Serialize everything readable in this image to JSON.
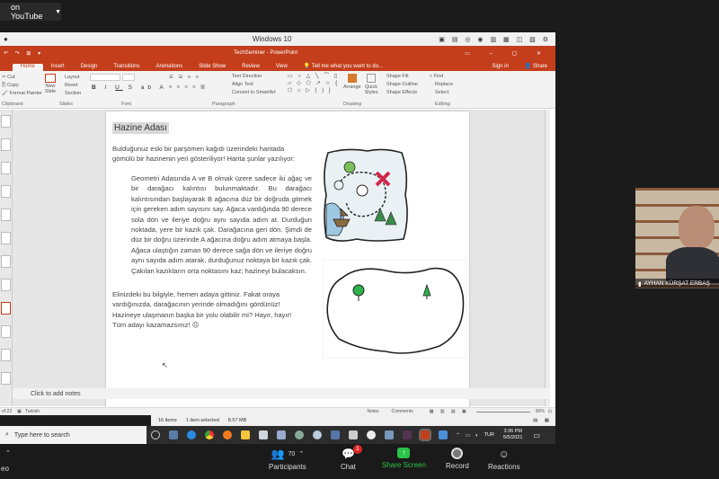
{
  "youtube": {
    "label": "on YouTube"
  },
  "titlebar": {
    "title": "Windows 10"
  },
  "ppt": {
    "doc_title": "TechSeminer - PowerPoint",
    "sign_in": "Sign in",
    "share": "Share"
  },
  "tabs": [
    "Home",
    "Insert",
    "Design",
    "Transitions",
    "Animations",
    "Slide Show",
    "Review",
    "View"
  ],
  "tell_me": "Tell me what you want to do...",
  "ribbon": {
    "clipboard": {
      "cut": "Cut",
      "copy": "Copy",
      "format_painter": "Format Painter",
      "group": "Clipboard"
    },
    "slides": {
      "new_slide": "New Slide",
      "layout": "Layout",
      "reset": "Reset",
      "section": "Section",
      "group": "Slides"
    },
    "font": {
      "group": "Font"
    },
    "paragraph": {
      "text_direction": "Text Direction",
      "align_text": "Align Text",
      "smartart": "Convert to SmartArt",
      "group": "Paragraph"
    },
    "drawing": {
      "arrange": "Arrange",
      "quick_styles": "Quick Styles",
      "shape_fill": "Shape Fill",
      "shape_outline": "Shape Outline",
      "shape_effects": "Shape Effects",
      "group": "Drawing"
    },
    "editing": {
      "find": "Find",
      "replace": "Replace",
      "select": "Select",
      "group": "Editing"
    }
  },
  "slide": {
    "title": "Hazine Adası",
    "intro": "Bulduğunuz eski bir parşömen kağıdı üzerindeki haritada gömülü bir hazinenin yeri gösteriliyor! Harita şunlar yazılıyor:",
    "quote": "Geometri Adasında A ve B olmak üzere sadece iki ağaç ve bir darağacı kalıntısı bulunmaktadır. Bu darağacı kalıntısından başlayarak B ağacına düz bir doğruda gitmek için gereken adım sayısını say. Ağaca vardığında 90 derece sola dön ve ileriye doğru aynı sayıda adım at. Durduğun noktada, yere bir kazık çak. Darağacına geri dön. Şimdi de düz bir doğru üzerinde A ağacına doğru adım atmaya başla. Ağaca ulaştığın zaman 90 derece sağa dön ve ileriye doğru aynı sayıda adım atarak, durduğunuz noktaya bir kazık çak. Çakılan kazıkların orta noktasını kaz; hazineyi bulacaksın.",
    "outro": "Elinizdeki bu bilgiyle, hemen adaya gittiniz. Fakat oraya vardığınızda, darağacının yerinde olmadığını gördünüz! Hazineye ulaşmanın başka bir yolu olabilir mi? Hayır, hayır! Tüm adayı kazamazsınız! ☹"
  },
  "notes": "Click to add notes",
  "status": {
    "slide": "of 23",
    "lang": "Turkish",
    "notes": "Notes",
    "comments": "Comments",
    "zoom": "90%"
  },
  "explorer": {
    "items": "16 items",
    "selected": "1 item selected",
    "size": "8.57 MB"
  },
  "taskbar": {
    "search": "Type here to search",
    "lang": "TUR",
    "time": "3:36 PM",
    "date": "5/5/2021"
  },
  "video": {
    "name": "AYHAN KÜRŞAT ERBAŞ"
  },
  "zoom_toolbar": {
    "participants": "Participants",
    "participants_count": "70",
    "chat": "Chat",
    "chat_badge": "1",
    "share": "Share Screen",
    "record": "Record",
    "reactions": "Reactions",
    "left_fragment": "eo"
  },
  "colors": {
    "ppt_accent": "#c43e1c",
    "share_green": "#2cc34a",
    "badge_red": "#e02828"
  }
}
